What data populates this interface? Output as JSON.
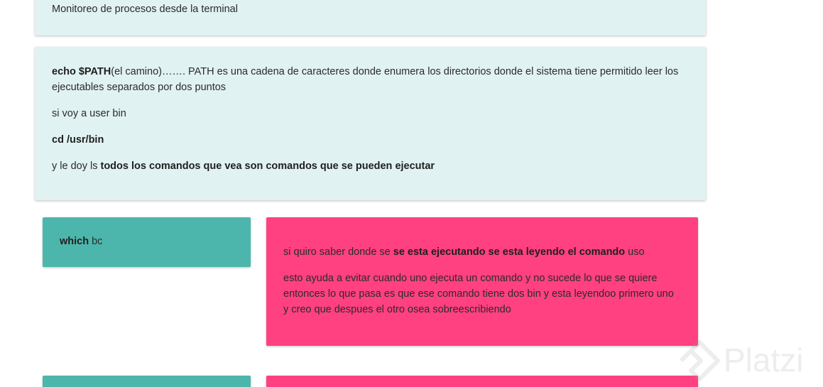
{
  "top_card": {
    "text": "Monitoreo de procesos desde la terminal"
  },
  "path_card": {
    "p1_bold": "echo $PATH",
    "p1_text": "(el camino)……. PATH es una cadena de caracteres donde enumera los directorios donde el sistema tiene permitido leer los ejecutables separados por dos puntos",
    "p2_text": "si voy a user bin",
    "p3_bold": "cd /usr/bin",
    "p4_text": "y le doy ls ",
    "p4_bold": "todos los comandos que vea son comandos que se pueden ejecutar"
  },
  "which_card": {
    "bold": "which",
    "text": " bc"
  },
  "explain_card": {
    "p1_text_a": "si quiro saber donde se ",
    "p1_bold": "se esta ejecutando se esta leyendo el comando",
    "p1_text_b": " uso",
    "p2_text": "esto ayuda a evitar cuando uno ejecuta un comando y no sucede lo que se quiere entonces lo que pasa es que ese comando tiene dos bin y esta leyendoo primero uno y creo que despues el otro osea sobreescribiendo"
  },
  "watermark": {
    "brand": "Platzi",
    "logo_icon": "platzi-logo-icon"
  },
  "colors": {
    "light_card": "#e0f2f1",
    "teal_card": "#4db6ac",
    "pink_card": "#ff4081"
  }
}
